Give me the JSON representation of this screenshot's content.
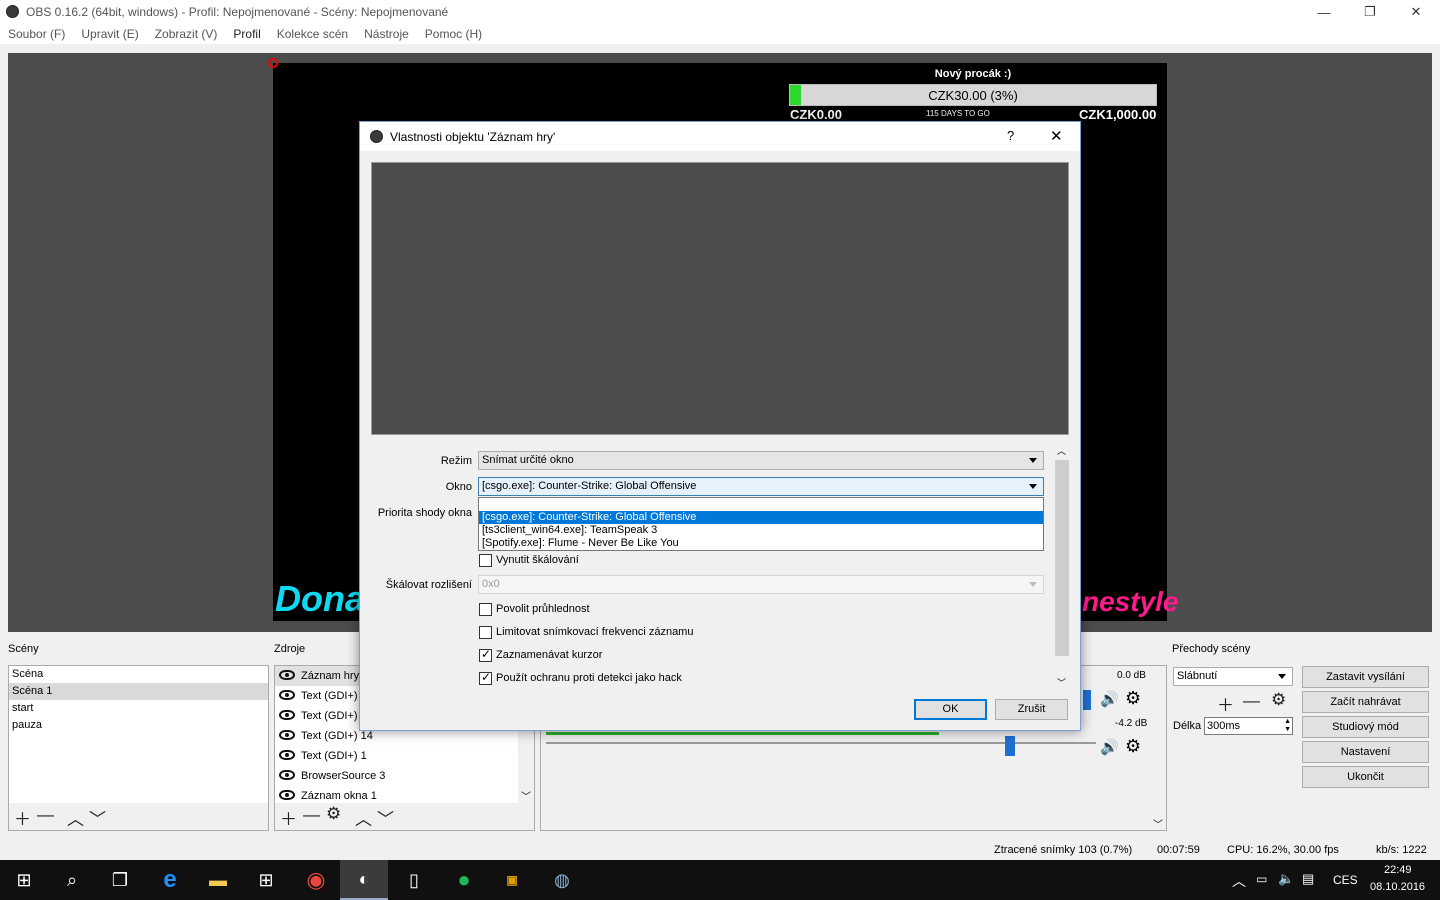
{
  "window": {
    "title": "OBS 0.16.2 (64bit, windows) - Profil: Nepojmenované - Scény: Nepojmenované",
    "minimize": "—",
    "maximize": "❐",
    "close": "✕"
  },
  "menu": [
    "Soubor (F)",
    "Upravit (E)",
    "Zobrazit (V)",
    "Profil",
    "Kolekce scén",
    "Nástroje",
    "Pomoc (H)"
  ],
  "preview": {
    "goal_title": "Nový procák :)",
    "goal_value": "CZK30.00 (3%)",
    "goal_progress_percent": 3,
    "goal_min": "CZK0.00",
    "goal_max": "CZK1,000.00",
    "goal_days": "115 DAYS TO GO",
    "left_text": "Dona",
    "right_text": "nestyle",
    "colors": {
      "left_text": "#0fd8f0",
      "right_text": "#ff1a8c",
      "goal_fill": "#2bd82b"
    }
  },
  "scenes": {
    "label": "Scény",
    "items": [
      "Scéna",
      "Scéna 1",
      "start",
      "pauza"
    ],
    "selected": "Scéna 1"
  },
  "sources": {
    "label": "Zdroje",
    "items": [
      "Záznam hry",
      "Text (GDI+)",
      "Text (GDI+)",
      "Text (GDI+) 14",
      "Text (GDI+) 1",
      "BrowserSource 3",
      "Záznam okna 1"
    ]
  },
  "mixer": {
    "db1": "0.0 dB",
    "db2": "-4.2 dB"
  },
  "transitions": {
    "label": "Přechody scény",
    "selected": "Slábnutí",
    "duration_label": "Délka",
    "duration_value": "300ms"
  },
  "controls": [
    "Zastavit vysílání",
    "Začít nahrávat",
    "Studiový mód",
    "Nastavení",
    "Ukončit"
  ],
  "status": {
    "dropped": "Ztracené snímky 103 (0.7%)",
    "time": "00:07:59",
    "cpu": "CPU: 16.2%, 30.00 fps",
    "kbs": "kb/s: 1222"
  },
  "taskbar": {
    "lang": "CES",
    "clock_time": "22:49",
    "clock_date": "08.10.2016"
  },
  "dialog": {
    "title": "Vlastnosti objektu 'Záznam hry'",
    "help": "?",
    "close": "✕",
    "mode_label": "Režim",
    "mode_value": "Snímat určité okno",
    "window_label": "Okno",
    "window_value": "[csgo.exe]: Counter-Strike: Global Offensive",
    "priority_label": "Priorita shody okna",
    "dropdown_options": [
      "[csgo.exe]: Counter-Strike: Global Offensive",
      "[ts3client_win64.exe]: TeamSpeak 3",
      "[Spotify.exe]: Flume - Never Be Like You"
    ],
    "force_scaling": "Vynutit škálování",
    "scale_label": "Škálovat rozlišení",
    "scale_value": "0x0",
    "allow_transparency": "Povolit průhlednost",
    "limit_framerate": "Limitovat snímkovací frekvenci záznamu",
    "capture_cursor": "Zaznamenávat kurzor",
    "anti_cheat": "Použít ochranu proti detekci jako hack",
    "ok": "OK",
    "cancel": "Zrušit"
  }
}
